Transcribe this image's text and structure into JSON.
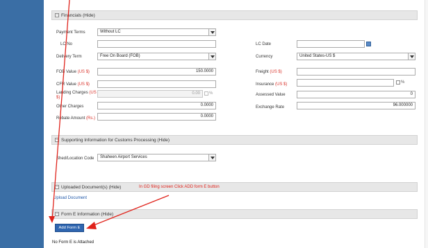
{
  "financials": {
    "header": "Financials (Hide)",
    "payment_terms_label": "Payment Terms",
    "payment_terms_value": "Without LC",
    "lc_no_label": "LC No",
    "lc_no_value": "",
    "lc_date_label": "LC Date",
    "lc_date_value": "",
    "delivery_term_label": "Delivery Term",
    "delivery_term_value": "Free On Board (FOB)",
    "currency_label": "Currency",
    "currency_value": "United States-US $",
    "fob_label": "FOB Value",
    "fob_cur": "(US $)",
    "fob_value": "150.0000",
    "freight_label": "Freight",
    "freight_cur": "(US $)",
    "freight_value": "",
    "cfr_label": "CFR Value",
    "cfr_cur": "(US $)",
    "cfr_value": "",
    "insurance_label": "Insurance",
    "insurance_cur": "(US $)",
    "insurance_value": "",
    "insurance_pct": "%",
    "landing_label": "Landing Charges",
    "landing_cur": "(US $)",
    "landing_value": "0.00",
    "landing_pct": "%",
    "assessed_label": "Assessed Value",
    "assessed_value": "0",
    "other_label": "Other Charges",
    "other_value": "0.0000",
    "exchange_label": "Exchange Rate",
    "exchange_value": "96.000000",
    "rebate_label": "Rebate Amount",
    "rebate_cur": "(Rs.)",
    "rebate_value": "0.0000"
  },
  "supporting": {
    "header": "Supporting Information for Customs Processing (Hide)",
    "shed_label": "Shed/Location Code",
    "shed_value": "Shaheen Airport Services"
  },
  "uploaded": {
    "header": "Uploaded Document(s) (Hide)",
    "upload_link": "Upload Document"
  },
  "forme": {
    "header": "Form E Information (Hide)",
    "add_button": "Add Form E",
    "empty_note": "No Form E is Attached"
  },
  "annotation": {
    "text": "In GD filing screen Click ADD form E button",
    "color": "#e0231b"
  },
  "colors": {
    "sidebar": "#3a6ea5",
    "button": "#2f66b0",
    "currency_text": "#d9332b"
  },
  "icons": {
    "collapse": "minus-box-icon",
    "calendar": "calendar-icon",
    "dropdown": "chevron-down-icon"
  }
}
